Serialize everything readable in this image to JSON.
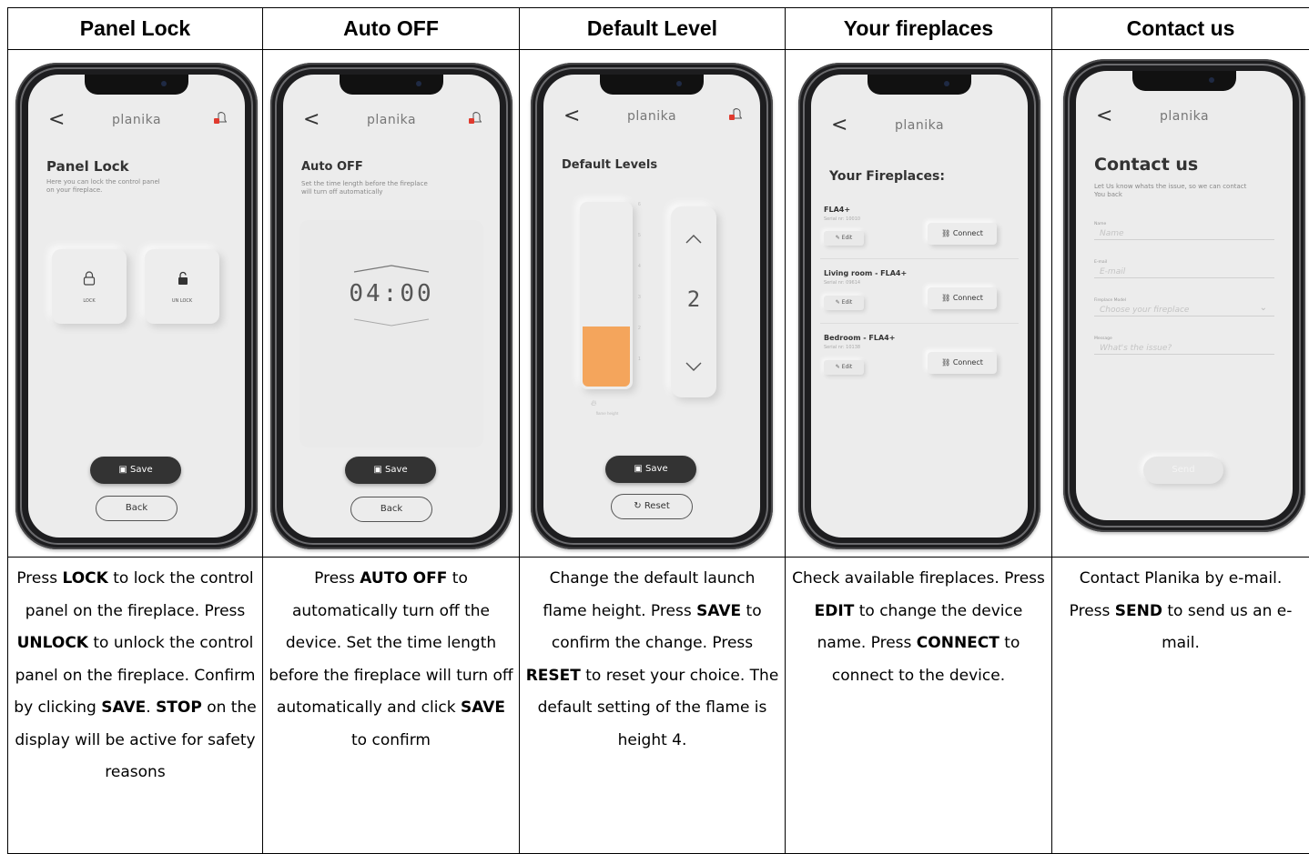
{
  "columns": [
    {
      "title": "Panel Lock"
    },
    {
      "title": "Auto OFF"
    },
    {
      "title": "Default Level"
    },
    {
      "title": "Your fireplaces"
    },
    {
      "title": "Contact us"
    }
  ],
  "phone": {
    "brand": "planika",
    "back_glyph": "<"
  },
  "panel_lock": {
    "title": "Panel Lock",
    "subtitle_line1": "Here you can lock the control panel",
    "subtitle_line2": "on your fireplace.",
    "lock_label": "LOCK",
    "unlock_label": "UN LOCK",
    "save_label": "Save",
    "back_label": "Back"
  },
  "auto_off": {
    "title": "Auto OFF",
    "subtitle_line1": "Set the time length before the fireplace",
    "subtitle_line2": "will turn off automatically",
    "time_value": "04:00",
    "save_label": "Save",
    "back_label": "Back"
  },
  "default_level": {
    "title": "Default Levels",
    "level_value": "2",
    "level_fraction": 0.33,
    "scale_ticks": [
      "6",
      "5",
      "4",
      "3",
      "2",
      "1"
    ],
    "flame_label": "flame height",
    "save_label": "Save",
    "reset_label": "Reset"
  },
  "fireplaces": {
    "title": "Your Fireplaces:",
    "items": [
      {
        "name": "FLA4+",
        "serial": "Serial nr: 10010",
        "edit_label": "Edit",
        "connect_label": "Connect"
      },
      {
        "name": "Living room - FLA4+",
        "serial": "Serial nr: 09614",
        "edit_label": "Edit",
        "connect_label": "Connect"
      },
      {
        "name": "Bedroom - FLA4+",
        "serial": "Serial nr: 10138",
        "edit_label": "Edit",
        "connect_label": "Connect"
      }
    ]
  },
  "contact": {
    "title": "Contact us",
    "subtitle_line1": "Let Us know whats the issue, so we can contact",
    "subtitle_line2": "You back",
    "fields": [
      {
        "label": "Name",
        "placeholder": "Name"
      },
      {
        "label": "E-mail",
        "placeholder": "E-mail"
      },
      {
        "label": "Fireplace Model",
        "placeholder": "Choose your fireplace"
      },
      {
        "label": "Message",
        "placeholder": "What's the issue?"
      }
    ],
    "send_label": "Send"
  },
  "descriptions": {
    "panel_lock": [
      {
        "t": "Press "
      },
      {
        "b": "LOCK"
      },
      {
        "t": " to lock the control panel on the fireplace. Press "
      },
      {
        "b": "UNLOCK"
      },
      {
        "t": " to unlock the control panel on the fireplace. Confirm by clicking "
      },
      {
        "b": "SAVE"
      },
      {
        "t": ". "
      },
      {
        "b": "STOP"
      },
      {
        "t": " on the display will be active for safety reasons"
      }
    ],
    "auto_off": [
      {
        "t": "Press "
      },
      {
        "b": "AUTO OFF"
      },
      {
        "t": " to automatically turn off the device. Set the time length before the fireplace will turn off automatically and click "
      },
      {
        "b": "SAVE"
      },
      {
        "t": " to confirm"
      }
    ],
    "default_level": [
      {
        "t": "Change the default launch flame height. Press "
      },
      {
        "b": "SAVE"
      },
      {
        "t": " to confirm the change. Press "
      },
      {
        "b": "RESET"
      },
      {
        "t": " to reset your choice. The default setting of the flame is height 4."
      }
    ],
    "fireplaces": [
      {
        "t": "Check available fireplaces. Press "
      },
      {
        "b": "EDIT"
      },
      {
        "t": " to change the device name. Press "
      },
      {
        "b": "CONNECT"
      },
      {
        "t": " to connect to the device."
      }
    ],
    "contact": [
      {
        "t": "Contact Planika by e-mail. Press "
      },
      {
        "b": "SEND"
      },
      {
        "t": " to send us an e-mail."
      }
    ]
  },
  "colors": {
    "flame_fill": "#f4a55c",
    "lock_badge": "#e03a2e",
    "dark_button": "#333333"
  },
  "icons": [
    "back-icon",
    "bell-lock-icon",
    "padlock-closed-icon",
    "padlock-open-icon",
    "save-disk-icon",
    "chevron-up-icon",
    "chevron-down-icon",
    "flame-icon",
    "reset-icon",
    "edit-pencil-icon",
    "link-icon"
  ]
}
